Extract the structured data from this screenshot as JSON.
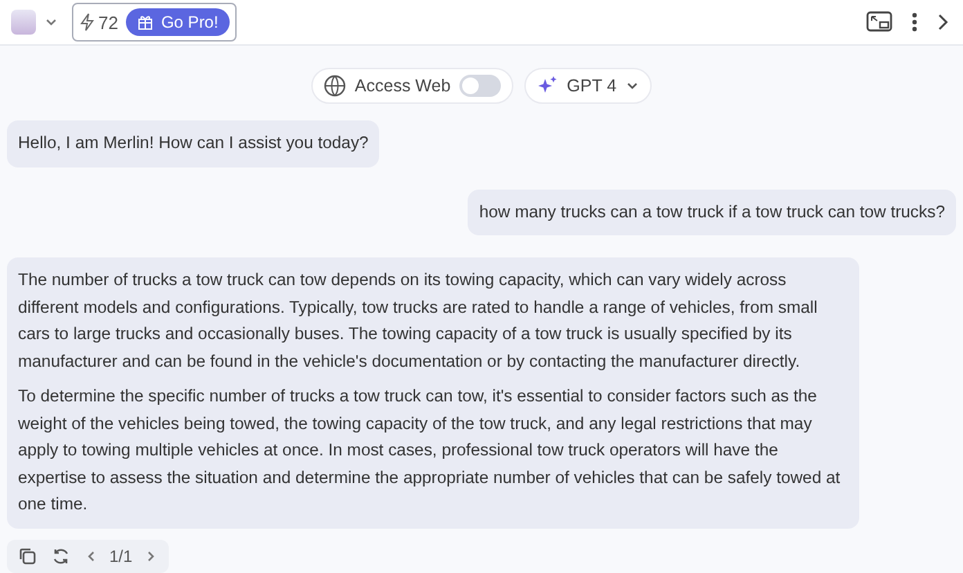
{
  "header": {
    "credits": "72",
    "upgrade": "Go Pro!"
  },
  "controls": {
    "access_web": {
      "label": "Access Web",
      "on": false
    },
    "model": "GPT 4"
  },
  "messages": [
    {
      "kind": "bot",
      "paragraphs": [
        "Hello, I am Merlin! How can I assist you today?"
      ]
    },
    {
      "kind": "user",
      "paragraphs": [
        "how many trucks can a tow truck if a tow truck can tow trucks?"
      ]
    },
    {
      "kind": "bot",
      "paragraphs": [
        "The number of trucks a tow truck can tow depends on its towing capacity, which can vary widely across different models and configurations. Typically, tow trucks are rated to handle a range of vehicles, from small cars to large trucks and occasionally buses. The towing capacity of a tow truck is usually specified by its manufacturer and can be found in the vehicle's documentation or by contacting the manufacturer directly.",
        "To determine the specific number of trucks a tow truck can tow, it's essential to consider factors such as the weight of the vehicles being towed, the towing capacity of the tow truck, and any legal restrictions that may apply to towing multiple vehicles at once. In most cases, professional tow truck operators will have the expertise to assess the situation and determine the appropriate number of vehicles that can be safely towed at one time."
      ]
    }
  ],
  "pager": "1/1"
}
